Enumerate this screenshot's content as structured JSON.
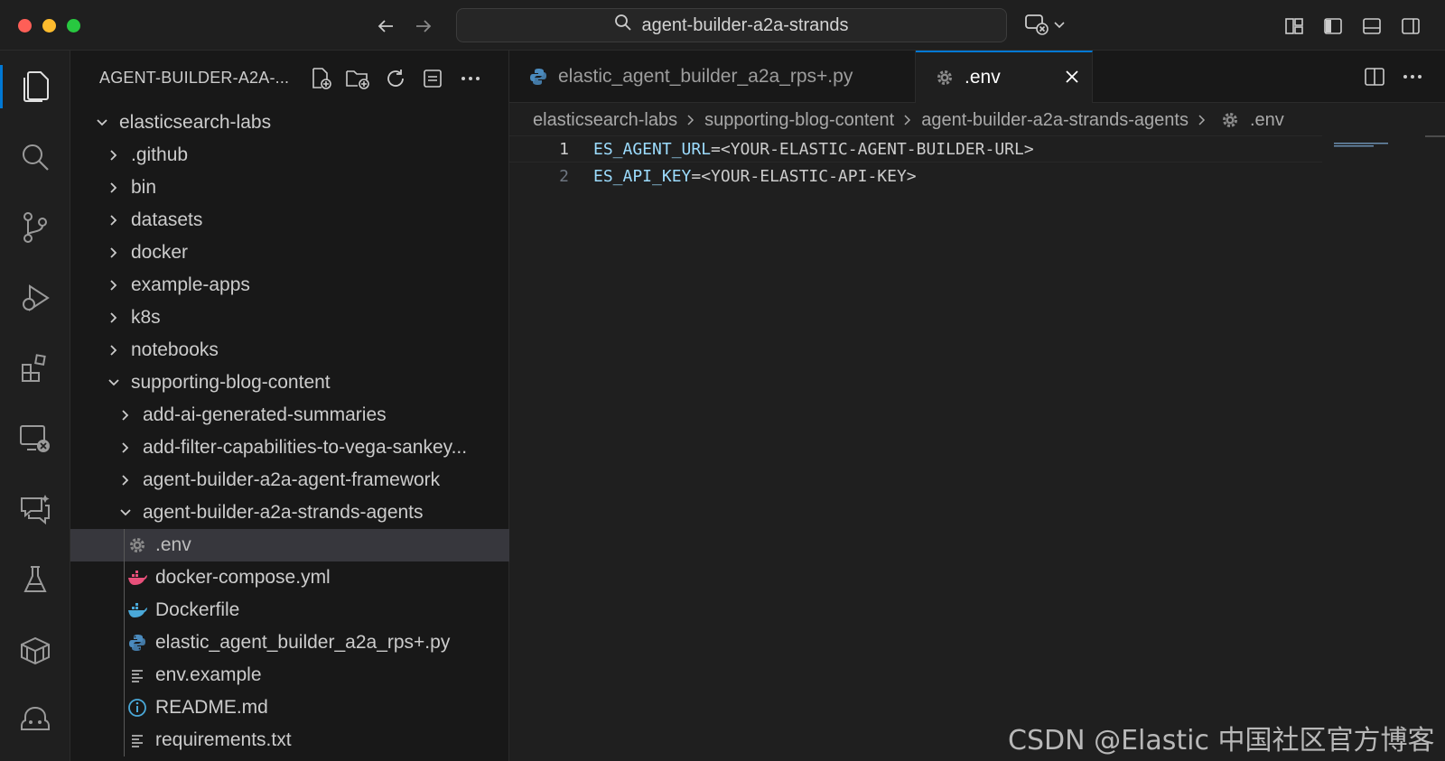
{
  "titlebar": {
    "search_text": "agent-builder-a2a-strands"
  },
  "icons": {
    "folder_color": "#c5c5c5",
    "python_color": "#4b8bbe",
    "docker_compose_color": "#e8507a",
    "docker_color": "#4aa8d8",
    "info_color": "#4aa8d8",
    "accent": "#0078d4"
  },
  "sidebar": {
    "title": "AGENT-BUILDER-A2A-...",
    "root": {
      "label": "elasticsearch-labs"
    },
    "folders": [
      {
        "label": ".github"
      },
      {
        "label": "bin"
      },
      {
        "label": "datasets"
      },
      {
        "label": "docker"
      },
      {
        "label": "example-apps"
      },
      {
        "label": "k8s"
      },
      {
        "label": "notebooks"
      }
    ],
    "blog": {
      "label": "supporting-blog-content"
    },
    "blog_folders": [
      {
        "label": "add-ai-generated-summaries"
      },
      {
        "label": "add-filter-capabilities-to-vega-sankey..."
      },
      {
        "label": "agent-builder-a2a-agent-framework"
      }
    ],
    "strands": {
      "label": "agent-builder-a2a-strands-agents"
    },
    "files": [
      {
        "label": ".env",
        "icon": "gear-icon"
      },
      {
        "label": "docker-compose.yml",
        "icon": "docker-compose-icon"
      },
      {
        "label": "Dockerfile",
        "icon": "docker-icon"
      },
      {
        "label": "elastic_agent_builder_a2a_rps+.py",
        "icon": "python-icon"
      },
      {
        "label": "env.example",
        "icon": "lines-icon"
      },
      {
        "label": "README.md",
        "icon": "info-icon"
      },
      {
        "label": "requirements.txt",
        "icon": "lines-icon"
      }
    ]
  },
  "editor": {
    "tabs": [
      {
        "label": "elastic_agent_builder_a2a_rps+.py"
      },
      {
        "label": ".env"
      }
    ],
    "breadcrumb": [
      "elasticsearch-labs",
      "supporting-blog-content",
      "agent-builder-a2a-strands-agents",
      ".env"
    ],
    "lines": [
      {
        "num": "1",
        "key": "ES_AGENT_URL",
        "rest": "=<YOUR-ELASTIC-AGENT-BUILDER-URL>"
      },
      {
        "num": "2",
        "key": "ES_API_KEY",
        "rest": "=<YOUR-ELASTIC-API-KEY>"
      }
    ]
  },
  "watermark": "CSDN @Elastic 中国社区官方博客"
}
